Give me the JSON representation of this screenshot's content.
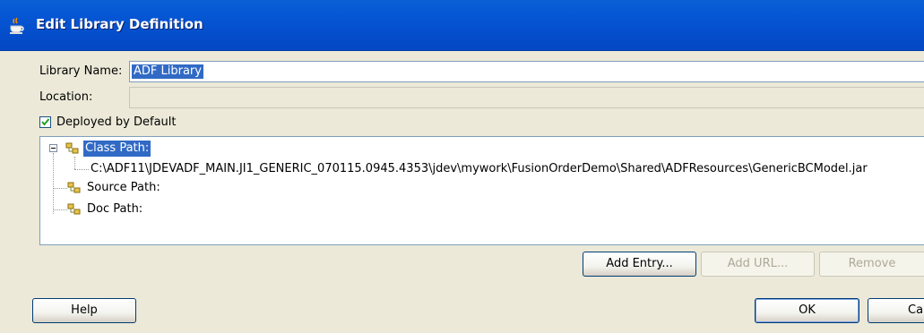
{
  "window": {
    "title": "Edit Library Definition"
  },
  "form": {
    "library_name_label": "Library Name:",
    "library_name_value": "ADF Library",
    "location_label": "Location:",
    "location_value": "",
    "deployed_label": "Deployed by Default",
    "deployed_checked": true
  },
  "tree": {
    "class_path_label": "Class Path:",
    "class_path_entry": "C:\\ADF11\\JDEVADF_MAIN.JI1_GENERIC_070115.0945.4353\\jdev\\mywork\\FusionOrderDemo\\Shared\\ADFResources\\GenericBCModel.jar",
    "source_path_label": "Source Path:",
    "doc_path_label": "Doc Path:"
  },
  "buttons": {
    "add_entry": "Add Entry...",
    "add_url": "Add URL...",
    "remove": "Remove",
    "help": "Help",
    "ok": "OK",
    "cancel": "Cancel"
  },
  "colors": {
    "titlebar": "#0554d2",
    "selection": "#316ac5",
    "dialog_bg": "#ece9d8",
    "folder": "#e8c34a"
  }
}
